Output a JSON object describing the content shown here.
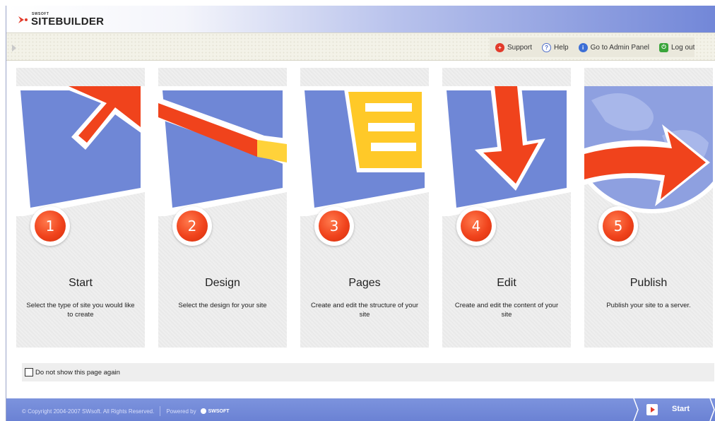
{
  "header": {
    "logo_small": "SWSOFT",
    "logo_main": "SITEBUILDER"
  },
  "toolbar": {
    "support": "Support",
    "help": "Help",
    "admin": "Go to Admin Panel",
    "logout": "Log out"
  },
  "steps": [
    {
      "number": "1",
      "title": "Start",
      "description": "Select the type of site you would like to create"
    },
    {
      "number": "2",
      "title": "Design",
      "description": "Select the design for your site"
    },
    {
      "number": "3",
      "title": "Pages",
      "description": "Create and edit the structure of your site"
    },
    {
      "number": "4",
      "title": "Edit",
      "description": "Create and edit the content of your site"
    },
    {
      "number": "5",
      "title": "Publish",
      "description": "Publish your site to a server."
    }
  ],
  "option": {
    "label": "Do not show this page again",
    "checked": false
  },
  "footer": {
    "copyright": "© Copyright 2004-2007 SWsoft. All Rights Reserved.",
    "powered": "Powered by",
    "brand": "SWSOFT",
    "start_label": "Start"
  },
  "colors": {
    "accent_red": "#f0431c",
    "panel_blue": "#6b82d4",
    "step_bg": "#ececec"
  }
}
